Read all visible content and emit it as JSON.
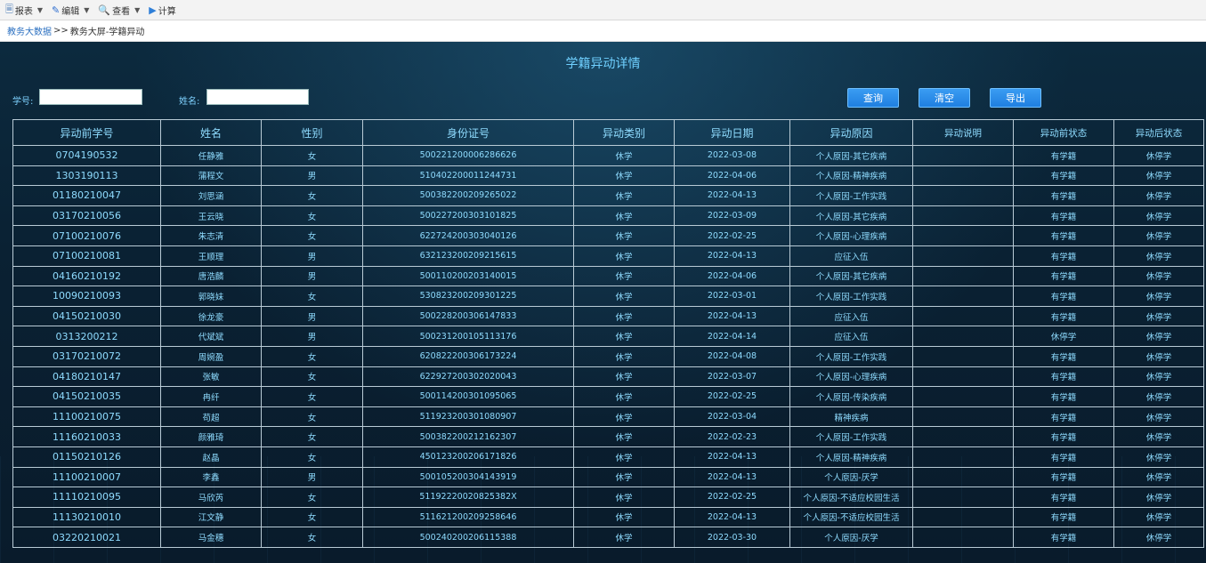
{
  "toolbar": {
    "items": [
      {
        "label": "报表",
        "icon": "report-icon",
        "has_caret": true
      },
      {
        "label": "编辑",
        "icon": "edit-icon",
        "has_caret": true
      },
      {
        "label": "查看",
        "icon": "view-icon",
        "has_caret": true
      },
      {
        "label": "计算",
        "icon": "play-icon",
        "has_caret": false
      }
    ]
  },
  "breadcrumb": {
    "home": "教务大数据",
    "separator": ">>",
    "current": "教务大屏-学籍异动"
  },
  "page": {
    "title": "学籍异动详情"
  },
  "filters": {
    "student_id_label": "学号:",
    "student_id_value": "",
    "name_label": "姓名:",
    "name_value": ""
  },
  "buttons": {
    "query": "查询",
    "clear": "清空",
    "export": "导出"
  },
  "colors": {
    "accent_text": "#8fdcff",
    "button_bg": "#2a8ce8",
    "panel_bg": "#0b2336"
  },
  "table": {
    "columns": [
      "异动前学号",
      "姓名",
      "性别",
      "身份证号",
      "异动类别",
      "异动日期",
      "异动原因",
      "异动说明",
      "异动前状态",
      "异动后状态"
    ],
    "rows": [
      [
        "0704190532",
        "任静雅",
        "女",
        "500221200006286626",
        "休学",
        "2022-03-08",
        "个人原因-其它疾病",
        "",
        "有学籍",
        "休停学"
      ],
      [
        "1303190113",
        "蒲程文",
        "男",
        "510402200011244731",
        "休学",
        "2022-04-06",
        "个人原因-精神疾病",
        "",
        "有学籍",
        "休停学"
      ],
      [
        "01180210047",
        "刘思涵",
        "女",
        "500382200209265022",
        "休学",
        "2022-04-13",
        "个人原因-工作实践",
        "",
        "有学籍",
        "休停学"
      ],
      [
        "03170210056",
        "王云晓",
        "女",
        "500227200303101825",
        "休学",
        "2022-03-09",
        "个人原因-其它疾病",
        "",
        "有学籍",
        "休停学"
      ],
      [
        "07100210076",
        "朱志清",
        "女",
        "622724200303040126",
        "休学",
        "2022-02-25",
        "个人原因-心理疾病",
        "",
        "有学籍",
        "休停学"
      ],
      [
        "07100210081",
        "王顺理",
        "男",
        "632123200209215615",
        "休学",
        "2022-04-13",
        "应征入伍",
        "",
        "有学籍",
        "休停学"
      ],
      [
        "04160210192",
        "唐浩麟",
        "男",
        "500110200203140015",
        "休学",
        "2022-04-06",
        "个人原因-其它疾病",
        "",
        "有学籍",
        "休停学"
      ],
      [
        "10090210093",
        "郭晓妹",
        "女",
        "530823200209301225",
        "休学",
        "2022-03-01",
        "个人原因-工作实践",
        "",
        "有学籍",
        "休停学"
      ],
      [
        "04150210030",
        "徐龙豪",
        "男",
        "500228200306147833",
        "休学",
        "2022-04-13",
        "应征入伍",
        "",
        "有学籍",
        "休停学"
      ],
      [
        "0313200212",
        "代斌斌",
        "男",
        "500231200105113176",
        "休学",
        "2022-04-14",
        "应征入伍",
        "",
        "休停学",
        "休停学"
      ],
      [
        "03170210072",
        "周婉盈",
        "女",
        "620822200306173224",
        "休学",
        "2022-04-08",
        "个人原因-工作实践",
        "",
        "有学籍",
        "休停学"
      ],
      [
        "04180210147",
        "张敏",
        "女",
        "622927200302020043",
        "休学",
        "2022-03-07",
        "个人原因-心理疾病",
        "",
        "有学籍",
        "休停学"
      ],
      [
        "04150210035",
        "冉纤",
        "女",
        "500114200301095065",
        "休学",
        "2022-02-25",
        "个人原因-传染疾病",
        "",
        "有学籍",
        "休停学"
      ],
      [
        "11100210075",
        "苟超",
        "女",
        "511923200301080907",
        "休学",
        "2022-03-04",
        "精神疾病",
        "",
        "有学籍",
        "休停学"
      ],
      [
        "11160210033",
        "颜雅琦",
        "女",
        "500382200212162307",
        "休学",
        "2022-02-23",
        "个人原因-工作实践",
        "",
        "有学籍",
        "休停学"
      ],
      [
        "01150210126",
        "赵晶",
        "女",
        "450123200206171826",
        "休学",
        "2022-04-13",
        "个人原因-精神疾病",
        "",
        "有学籍",
        "休停学"
      ],
      [
        "11100210007",
        "李鑫",
        "男",
        "500105200304143919",
        "休学",
        "2022-04-13",
        "个人原因-厌学",
        "",
        "有学籍",
        "休停学"
      ],
      [
        "11110210095",
        "马欣芮",
        "女",
        "51192220020825382X",
        "休学",
        "2022-02-25",
        "个人原因-不适应校园生活",
        "",
        "有学籍",
        "休停学"
      ],
      [
        "11130210010",
        "江文静",
        "女",
        "511621200209258646",
        "休学",
        "2022-04-13",
        "个人原因-不适应校园生活",
        "",
        "有学籍",
        "休停学"
      ],
      [
        "03220210021",
        "马金穗",
        "女",
        "500240200206115388",
        "休学",
        "2022-03-30",
        "个人原因-厌学",
        "",
        "有学籍",
        "休停学"
      ]
    ]
  }
}
